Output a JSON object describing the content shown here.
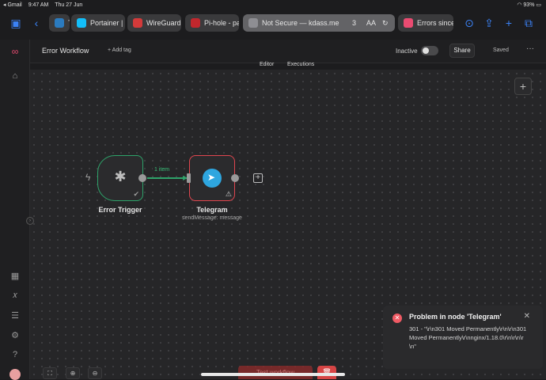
{
  "status_bar": {
    "carrier": "◂ Gmail",
    "time": "9:47 AM",
    "date": "Thu 27 Jun",
    "battery": "93%"
  },
  "browser_tabs": [
    {
      "label": "Ti",
      "color": "#2b7bbf"
    },
    {
      "label": "Portainer | l",
      "color": "#13bef9"
    },
    {
      "label": "WireGuard",
      "color": "#d33a3a"
    },
    {
      "label": "Pi-hole - pa",
      "color": "#c1272d"
    },
    {
      "label": "Not Secure — kdass.me",
      "color": "#8e8e93",
      "extra": "3",
      "aa": "AA"
    },
    {
      "label": "Errors since",
      "color": "#ea4b71"
    }
  ],
  "header": {
    "workflow_title": "Error Workflow",
    "add_tag": "+ Add tag",
    "active_state": "Inactive",
    "share_label": "Share",
    "saved_label": "Saved",
    "more_label": "···"
  },
  "modes": {
    "editor": "Editor",
    "executions": "Executions"
  },
  "nodes": {
    "trigger": {
      "label": "Error Trigger"
    },
    "telegram": {
      "label": "Telegram",
      "subtitle": "sendMessage: message"
    },
    "edge_label": "1 item"
  },
  "toast": {
    "title": "Problem in node 'Telegram'",
    "body": "301 - \"\\r\\n301 Moved Permanently\\r\\n\\r\\n301 Moved Permanently\\r\\nnginx/1.18.0\\r\\n\\r\\n\\r\\n\""
  },
  "footer": {
    "execute_label": "Test workflow"
  },
  "colors": {
    "success": "#2ea36a",
    "error": "#e0464f",
    "brand": "#ea4b71",
    "telegram": "#2ea6df"
  }
}
